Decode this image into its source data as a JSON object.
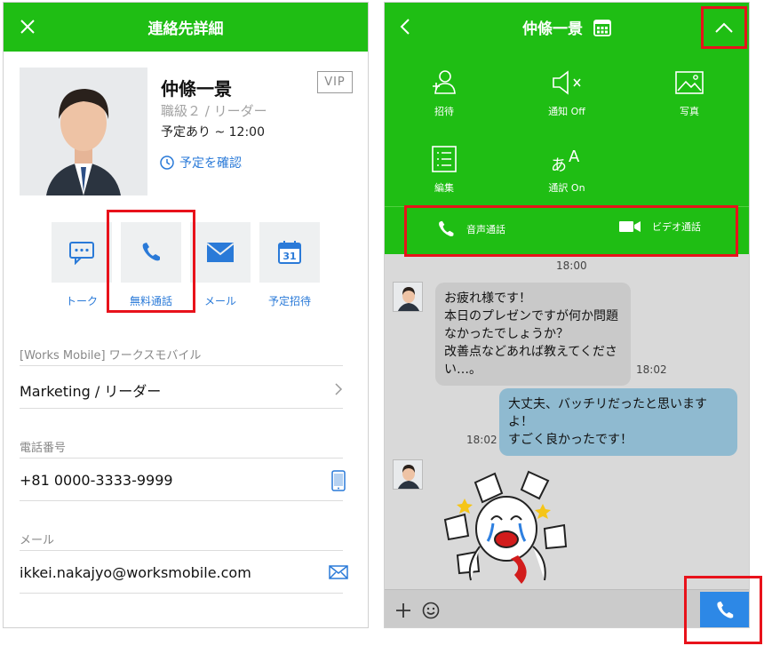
{
  "left": {
    "header_title": "連絡先詳細",
    "name": "仲條一景",
    "role": "職級２ / リーダー",
    "schedule": "予定あり ~ 12:00",
    "confirm_schedule": "予定を確認",
    "vip_badge": "VIP",
    "actions": [
      {
        "label": "トーク",
        "icon": "chat-icon"
      },
      {
        "label": "無料通話",
        "icon": "phone-icon"
      },
      {
        "label": "メール",
        "icon": "mail-icon"
      },
      {
        "label": "予定招待",
        "icon": "calendar-icon"
      }
    ],
    "calendar_day": "31",
    "org_label": "[Works Mobile] ワークスモバイル",
    "org_value": "Marketing / リーダー",
    "phone_label": "電話番号",
    "phone_value": "+81 0000-3333-9999",
    "mail_label": "メール",
    "mail_value": "ikkei.nakajyo@worksmobile.com"
  },
  "right": {
    "header_title": "仲條一景",
    "menu": [
      {
        "label": "招待",
        "icon": "invite-icon"
      },
      {
        "label": "通知 Off",
        "icon": "mute-icon"
      },
      {
        "label": "写真",
        "icon": "photo-icon"
      },
      {
        "label": "編集",
        "icon": "edit-list-icon"
      },
      {
        "label": "通訳 On",
        "icon": "translate-icon"
      }
    ],
    "voice_call": "音声通話",
    "video_call": "ビデオ通話",
    "time_top": "18:00",
    "msg1": "お疲れ様です！\n本日のプレゼンですが何か問題なかったでしょうか？\n改善点などあれば教えてください…。",
    "msg1_time": "18:02",
    "msg2": "大丈夫、バッチリだったと思いますよ！\nすごく良かったです！",
    "msg2_time": "18:02"
  },
  "colors": {
    "accent": "#1fbe14",
    "link": "#2a7ad8",
    "highlight": "#e8121b",
    "call_button": "#2d88e6"
  }
}
